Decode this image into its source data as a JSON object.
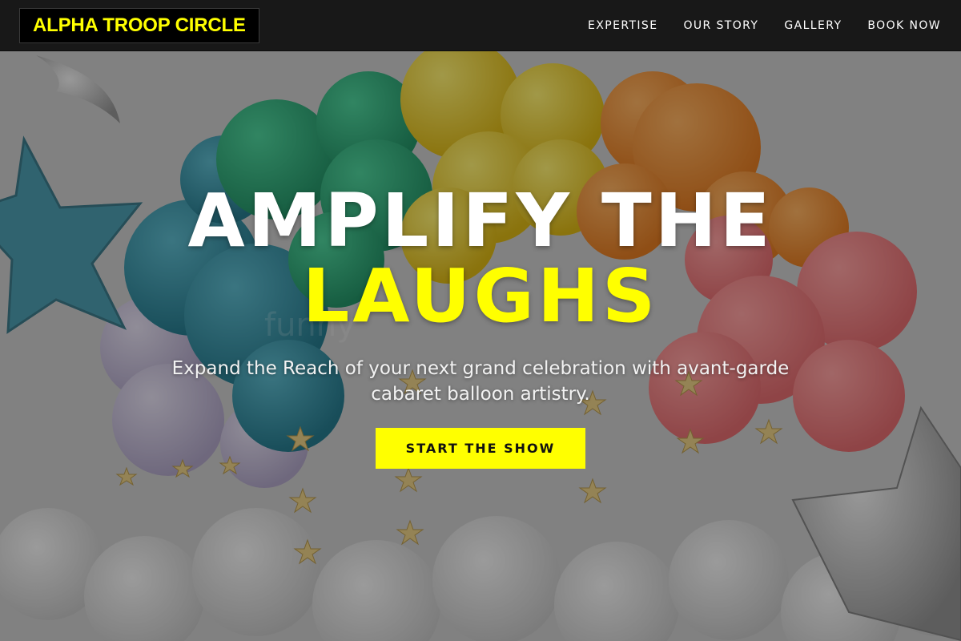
{
  "brand": {
    "name": "ALPHA TROOP CIRCLE",
    "color": "#ffff00"
  },
  "nav": {
    "items": [
      {
        "label": "EXPERTISE"
      },
      {
        "label": "OUR STORY"
      },
      {
        "label": "GALLERY"
      },
      {
        "label": "BOOK NOW"
      }
    ]
  },
  "hero": {
    "title_line1": "AMPLIFY THE",
    "title_line2": "LAUGHS",
    "subtitle": "Expand the Reach of your next grand celebration with avant-garde cabaret balloon artistry.",
    "cta_label": "START THE SHOW",
    "background_image_alt": "balloon garland with foil stars",
    "watermark": "funny"
  },
  "colors": {
    "accent": "#ffff00",
    "header_bg": "#181818",
    "text": "#ffffff"
  },
  "icons": {
    "star_decoration": "star-icon"
  }
}
